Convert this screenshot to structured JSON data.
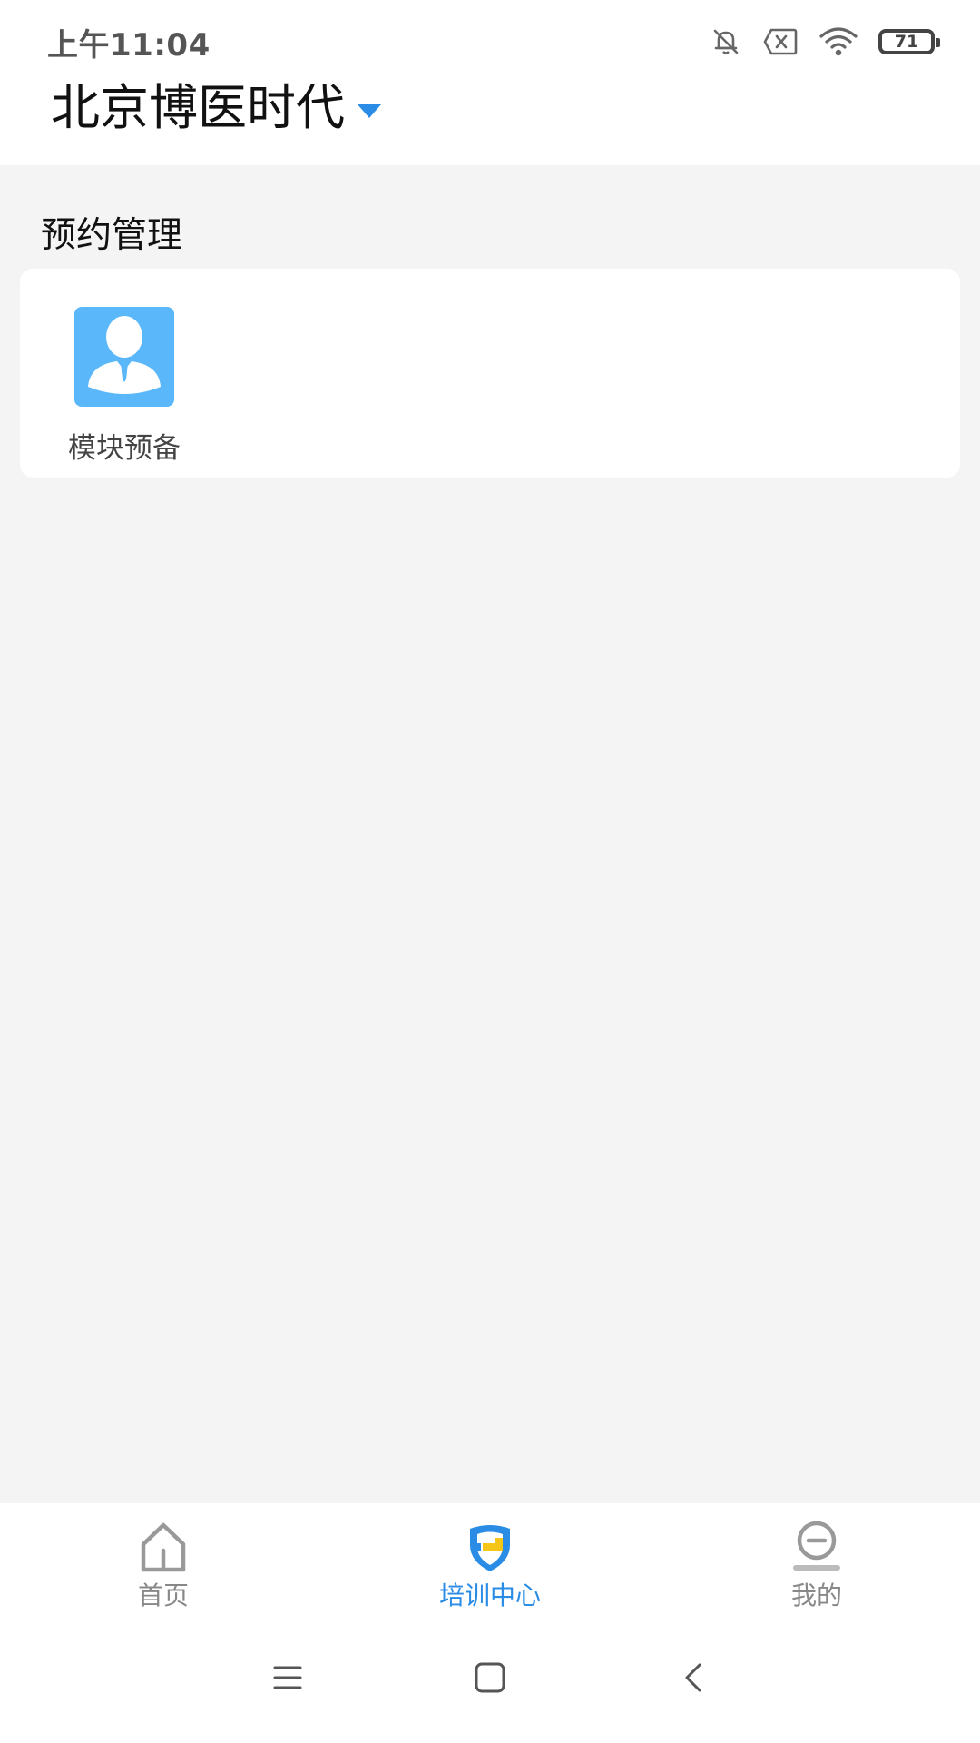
{
  "status_bar": {
    "time": "上午11:04",
    "battery_level": "71",
    "icons": [
      "mute-bell-icon",
      "sim-error-icon",
      "wifi-icon",
      "battery-icon"
    ]
  },
  "header": {
    "org_name": "北京博医时代"
  },
  "section": {
    "title": "预约管理",
    "items": [
      {
        "label": "模块预备",
        "icon": "user-avatar-icon"
      }
    ]
  },
  "bottom_nav": {
    "items": [
      {
        "label": "首页",
        "icon": "home-icon",
        "active": false
      },
      {
        "label": "培训中心",
        "icon": "training-shield-icon",
        "active": true
      },
      {
        "label": "我的",
        "icon": "profile-icon",
        "active": false
      }
    ]
  },
  "colors": {
    "accent": "#2b8ce6",
    "module_icon_bg": "#5ab8fa",
    "shield_yellow": "#f5c518",
    "background": "#f4f4f4"
  },
  "system_nav": [
    "menu-icon",
    "home-square-icon",
    "back-icon"
  ]
}
